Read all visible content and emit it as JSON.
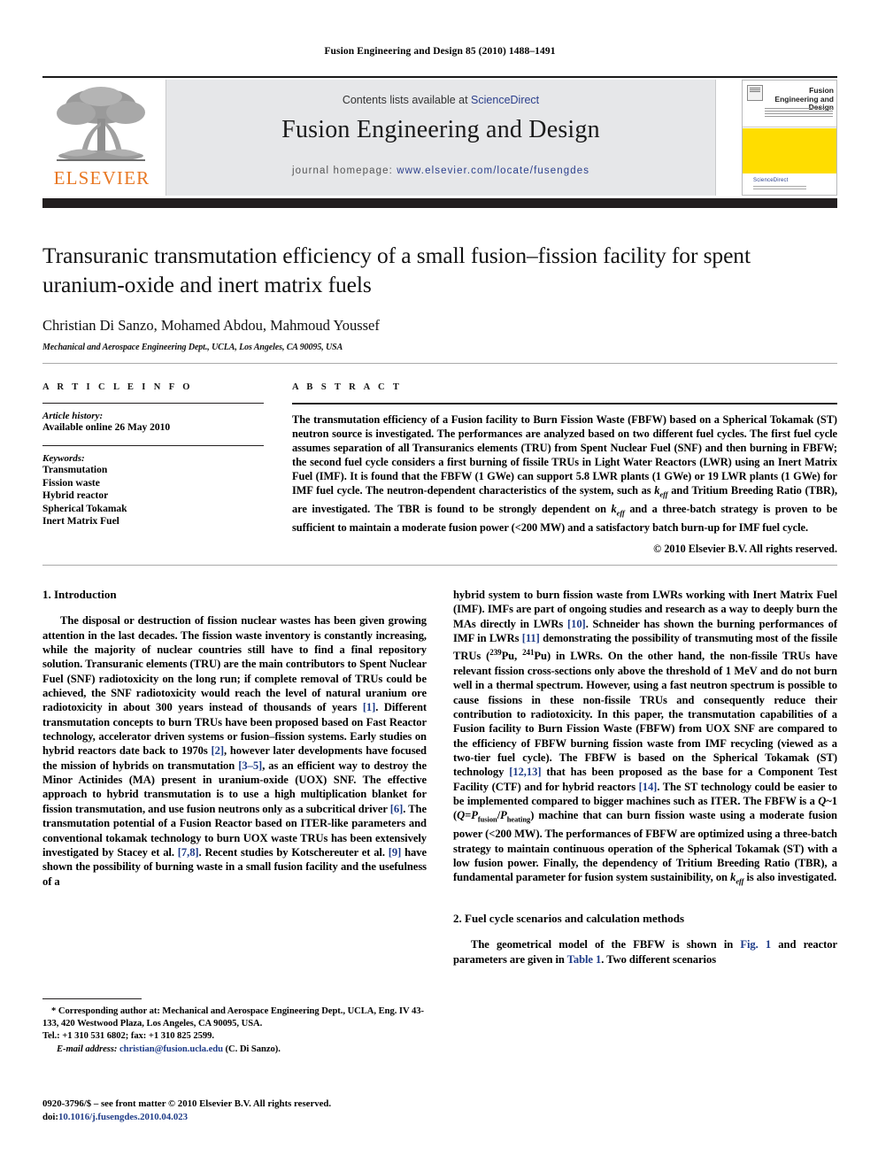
{
  "running_head": "Fusion Engineering and Design 85 (2010) 1488–1491",
  "masthead": {
    "contents_prefix": "Contents lists available at ",
    "contents_link": "ScienceDirect",
    "journal_title": "Fusion Engineering and Design",
    "homepage_label": "journal homepage:",
    "homepage_url": "www.elsevier.com/locate/fusengdes",
    "publisher_name": "ELSEVIER",
    "cover": {
      "title": "Fusion Engineering and Design",
      "sciencedirect": "ScienceDirect",
      "accent_yellow": "#ffdd00"
    }
  },
  "article": {
    "title": "Transuranic transmutation efficiency of a small fusion–fission facility for spent uranium-oxide and inert matrix fuels",
    "authors": "Christian Di Sanzo, Mohamed Abdou, Mahmoud Youssef",
    "corresponding_marker": "*",
    "affiliation": "Mechanical and Aerospace Engineering Dept., UCLA, Los Angeles, CA 90095, USA"
  },
  "article_info": {
    "heading": "A R T I C L E    I N F O",
    "history_label": "Article history:",
    "history_value": "Available online 26 May 2010",
    "keywords_label": "Keywords:",
    "keywords": [
      "Transmutation",
      "Fission waste",
      "Hybrid reactor",
      "Spherical Tokamak",
      "Inert Matrix Fuel"
    ]
  },
  "abstract": {
    "heading": "A B S T R A C T",
    "text": "The transmutation efficiency of a Fusion facility to Burn Fission Waste (FBFW) based on a Spherical Tokamak (ST) neutron source is investigated. The performances are analyzed based on two different fuel cycles. The first fuel cycle assumes separation of all Transuranics elements (TRU) from Spent Nuclear Fuel (SNF) and then burning in FBFW; the second fuel cycle considers a first burning of fissile TRUs in Light Water Reactors (LWR) using an Inert Matrix Fuel (IMF). It is found that the FBFW (1 GWe) can support 5.8 LWR plants (1 GWe) or 19 LWR plants (1 GWe) for IMF fuel cycle. The neutron-dependent characteristics of the system, such as keff and Tritium Breeding Ratio (TBR), are investigated. The TBR is found to be strongly dependent on keff and a three-batch strategy is proven to be sufficient to maintain a moderate fusion power (<200 MW) and a satisfactory batch burn-up for IMF fuel cycle.",
    "copyright": "© 2010 Elsevier B.V. All rights reserved."
  },
  "sections": {
    "intro_heading": "1. Introduction",
    "methods_heading": "2. Fuel cycle scenarios and calculation methods"
  },
  "body": {
    "left_paragraph": "The disposal or destruction of fission nuclear wastes has been given growing attention in the last decades. The fission waste inventory is constantly increasing, while the majority of nuclear countries still have to find a final repository solution. Transuranic elements (TRU) are the main contributors to Spent Nuclear Fuel (SNF) radiotoxicity on the long run; if complete removal of TRUs could be achieved, the SNF radiotoxicity would reach the level of natural uranium ore radiotoxicity in about 300 years instead of thousands of years [1]. Different transmutation concepts to burn TRUs have been proposed based on Fast Reactor technology, accelerator driven systems or fusion–fission systems. Early studies on hybrid reactors date back to 1970s [2], however later developments have focused the mission of hybrids on transmutation [3–5], as an efficient way to destroy the Minor Actinides (MA) present in uranium-oxide (UOX) SNF. The effective approach to hybrid transmutation is to use a high multiplication blanket for fission transmutation, and use fusion neutrons only as a subcritical driver [6]. The transmutation potential of a Fusion Reactor based on ITER-like parameters and conventional tokamak technology to burn UOX waste TRUs has been extensively investigated by Stacey et al. [7,8]. Recent studies by Kotschereuter et al. [9] have shown the possibility of burning waste in a small fusion facility and the usefulness of a",
    "right_paragraph": "hybrid system to burn fission waste from LWRs working with Inert Matrix Fuel (IMF). IMFs are part of ongoing studies and research as a way to deeply burn the MAs directly in LWRs [10]. Schneider has shown the burning performances of IMF in LWRs [11] demonstrating the possibility of transmuting most of the fissile TRUs (239Pu, 241Pu) in LWRs. On the other hand, the non-fissile TRUs have relevant fission cross-sections only above the threshold of 1 MeV and do not burn well in a thermal spectrum. However, using a fast neutron spectrum is possible to cause fissions in these non-fissile TRUs and consequently reduce their contribution to radiotoxicity. In this paper, the transmutation capabilities of a Fusion facility to Burn Fission Waste (FBFW) from UOX SNF are compared to the efficiency of FBFW burning fission waste from IMF recycling (viewed as a two-tier fuel cycle). The FBFW is based on the Spherical Tokamak (ST) technology [12,13] that has been proposed as the base for a Component Test Facility (CTF) and for hybrid reactors [14]. The ST technology could be easier to be implemented compared to bigger machines such as ITER. The FBFW is a Q~1 (Q=Pfusion/Pheating) machine that can burn fission waste using a moderate fusion power (<200 MW). The performances of FBFW are optimized using a three-batch strategy to maintain continuous operation of the Spherical Tokamak (ST) with a low fusion power. Finally, the dependency of Tritium Breeding Ratio (TBR), a fundamental parameter for fusion system sustainibility, on keff is also investigated.",
    "methods_paragraph": "The geometrical model of the FBFW is shown in Fig. 1 and reactor parameters are given in Table 1. Two different scenarios"
  },
  "footnote": {
    "corresponding": "* Corresponding author at: Mechanical and Aerospace Engineering Dept., UCLA, Eng. IV 43-133, 420 Westwood Plaza, Los Angeles, CA 90095, USA.",
    "phone": "Tel.: +1 310 531 6802; fax: +1 310 825 2599.",
    "email_label": "E-mail address:",
    "email": "christian@fusion.ucla.edu",
    "email_owner": "(C. Di Sanzo)."
  },
  "imprint": {
    "line1": "0920-3796/$ – see front matter © 2010 Elsevier B.V. All rights reserved.",
    "doi_label": "doi:",
    "doi": "10.1016/j.fusengdes.2010.04.023"
  },
  "colors": {
    "link": "#1f3c88",
    "elsevier_orange": "#E87722",
    "band_gray": "#e6e7e9",
    "bar_black": "#231f20"
  }
}
